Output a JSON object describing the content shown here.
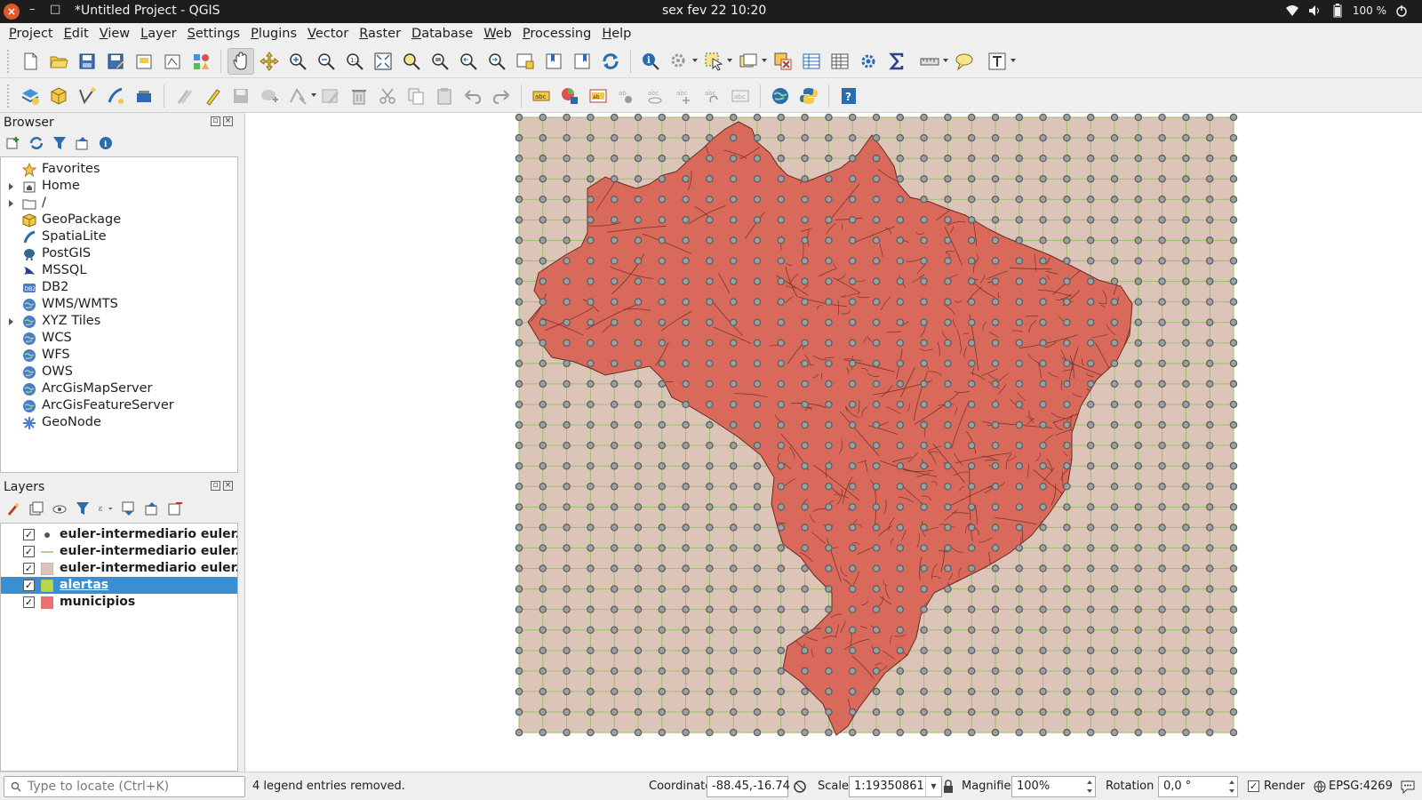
{
  "system_bar": {
    "close_glyph": "×",
    "minimize_glyph": "–",
    "maximize_glyph": "□",
    "window_title": "*Untitled Project - QGIS",
    "clock": "sex fev 22  10:20",
    "battery": "100 %"
  },
  "menu": [
    "Project",
    "Edit",
    "View",
    "Layer",
    "Settings",
    "Plugins",
    "Vector",
    "Raster",
    "Database",
    "Web",
    "Processing",
    "Help"
  ],
  "browser": {
    "title": "Browser",
    "items": [
      {
        "label": "Favorites",
        "icon": "star-icon",
        "expandable": false
      },
      {
        "label": "Home",
        "icon": "home-folder-icon",
        "expandable": true
      },
      {
        "label": "/",
        "icon": "folder-icon",
        "expandable": true
      },
      {
        "label": "GeoPackage",
        "icon": "geopackage-icon",
        "expandable": false
      },
      {
        "label": "SpatiaLite",
        "icon": "spatialite-icon",
        "expandable": false
      },
      {
        "label": "PostGIS",
        "icon": "postgis-icon",
        "expandable": false
      },
      {
        "label": "MSSQL",
        "icon": "mssql-icon",
        "expandable": false
      },
      {
        "label": "DB2",
        "icon": "db2-icon",
        "expandable": false
      },
      {
        "label": "WMS/WMTS",
        "icon": "globe-icon",
        "expandable": false
      },
      {
        "label": "XYZ Tiles",
        "icon": "globe-icon",
        "expandable": true
      },
      {
        "label": "WCS",
        "icon": "globe-icon",
        "expandable": false
      },
      {
        "label": "WFS",
        "icon": "globe-icon",
        "expandable": false
      },
      {
        "label": "OWS",
        "icon": "globe-icon",
        "expandable": false
      },
      {
        "label": "ArcGisMapServer",
        "icon": "globe-icon",
        "expandable": false
      },
      {
        "label": "ArcGisFeatureServer",
        "icon": "globe-icon",
        "expandable": false
      },
      {
        "label": "GeoNode",
        "icon": "geonode-icon",
        "expandable": false
      }
    ]
  },
  "layers": {
    "title": "Layers",
    "items": [
      {
        "name": "euler-intermediario euler...",
        "checked": true,
        "symbol": "point",
        "color": "#555555",
        "selected": false
      },
      {
        "name": "euler-intermediario euler...",
        "checked": true,
        "symbol": "line",
        "color": "#9bbf6a",
        "selected": false
      },
      {
        "name": "euler-intermediario euler...",
        "checked": true,
        "symbol": "polygon",
        "color": "#dcc5b8",
        "selected": false
      },
      {
        "name": "alertas",
        "checked": true,
        "symbol": "polygon",
        "color": "#b8d84a",
        "selected": true
      },
      {
        "name": "municipios",
        "checked": true,
        "symbol": "polygon",
        "color": "#f07070",
        "selected": false
      }
    ]
  },
  "map": {
    "background_color": "#ffffff",
    "grid_fill": "#dcc5b8",
    "grid_line": "#9bbf6a",
    "grid_point": "#5f5f5f",
    "country_fill": "#d9695b",
    "country_stroke": "#6a2a22"
  },
  "status": {
    "locator_placeholder": "Type to locate (Ctrl+K)",
    "message": "4 legend entries removed.",
    "coordinate_label": "Coordinate",
    "coordinate_value": "-88.45,-16.74",
    "scale_label": "Scale",
    "scale_value": "1:19350861",
    "magnifier_label": "Magnifier",
    "magnifier_value": "100%",
    "rotation_label": "Rotation",
    "rotation_value": "0,0 °",
    "render_label": "Render",
    "render_checked": true,
    "crs": "EPSG:4269"
  }
}
